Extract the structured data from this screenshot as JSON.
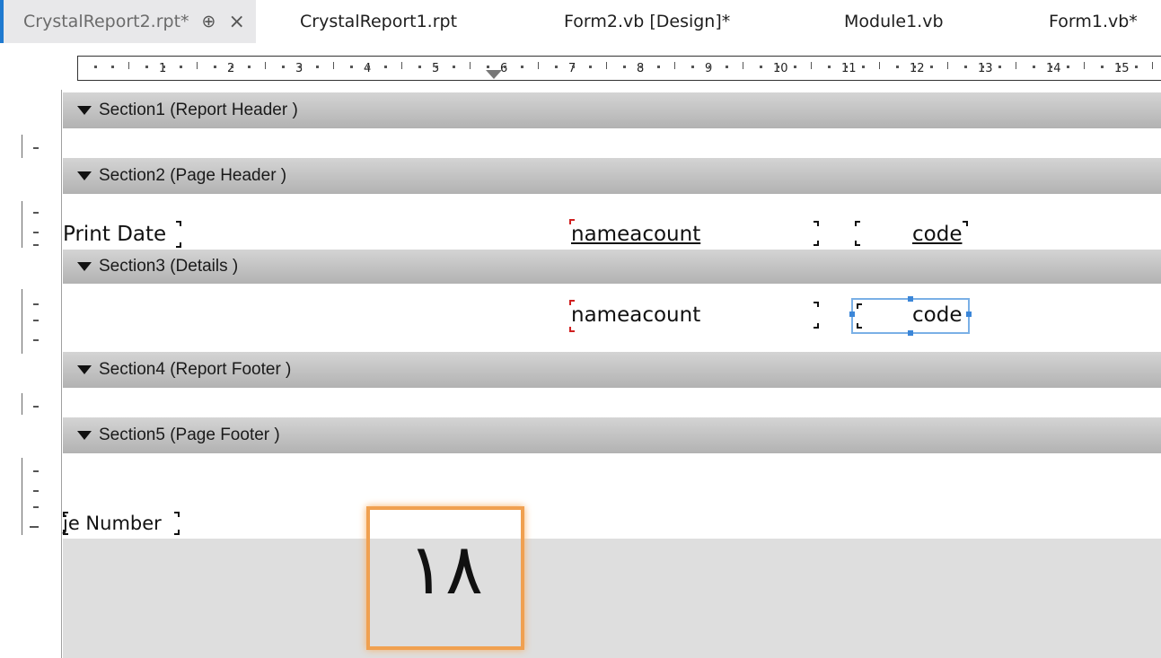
{
  "tabs": [
    {
      "label": "CrystalReport2.rpt*",
      "active": true
    },
    {
      "label": "CrystalReport1.rpt"
    },
    {
      "label": "Form2.vb [Design]*"
    },
    {
      "label": "Module1.vb"
    },
    {
      "label": "Form1.vb*"
    }
  ],
  "ruler": {
    "numbers": [
      "1",
      "2",
      "3",
      "4",
      "5",
      "6",
      "7",
      "8",
      "9",
      "10",
      "11",
      "12",
      "13",
      "14",
      "15"
    ]
  },
  "sections": [
    {
      "label": "Section1 (Report Header )"
    },
    {
      "label": "Section2 (Page Header )"
    },
    {
      "label": "Section3 (Details )"
    },
    {
      "label": "Section4 (Report Footer )"
    },
    {
      "label": "Section5 (Page Footer )"
    }
  ],
  "fields": {
    "print_date": "Print Date",
    "header_name": "nameacount",
    "header_code": "code",
    "detail_name": "nameacount",
    "detail_code": "code",
    "page_number": "je Number"
  },
  "overlay_number": "١٨",
  "colors": {
    "accent": "#1f7ad0",
    "selection": "#3b86d8",
    "highlight": "#f0a050"
  }
}
